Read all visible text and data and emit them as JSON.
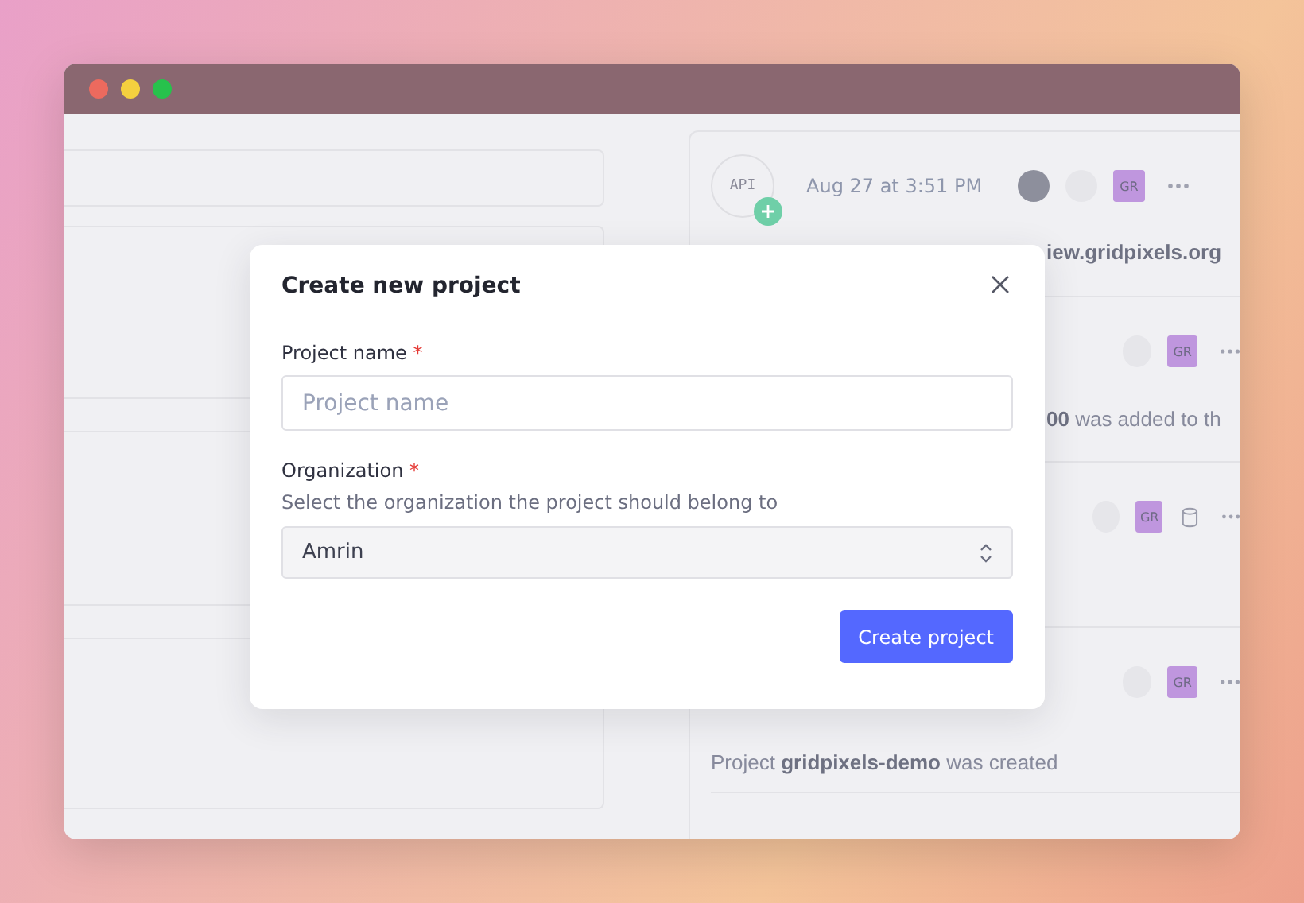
{
  "window": {
    "controls": [
      {
        "color": "#ec6a5e"
      },
      {
        "color": "#f4d03f"
      },
      {
        "color": "#27c24c"
      }
    ]
  },
  "feed": [
    {
      "badge": "API",
      "time": "Aug 27 at 3:51 PM",
      "initials": "GR",
      "photo": true,
      "storage": false,
      "message": "**iew.gridpixels.org**"
    },
    {
      "initials": "GR",
      "photo": false,
      "storage": false,
      "message": "**00** was added to th"
    },
    {
      "initials": "GR",
      "photo": false,
      "storage": true
    },
    {
      "initials": "GR",
      "photo": false,
      "storage": false,
      "message": "Project **gridpixels-demo** was created"
    }
  ],
  "dialog": {
    "title": "Create new project",
    "fields": [
      {
        "kind": "text",
        "label": "Project name",
        "required_mark": "*",
        "placeholder": "Project name"
      },
      {
        "kind": "select",
        "label": "Organization",
        "required_mark": "*",
        "hint": "Select the organization the project should belong to",
        "value": "Amrin"
      }
    ],
    "submit": "Create project"
  }
}
